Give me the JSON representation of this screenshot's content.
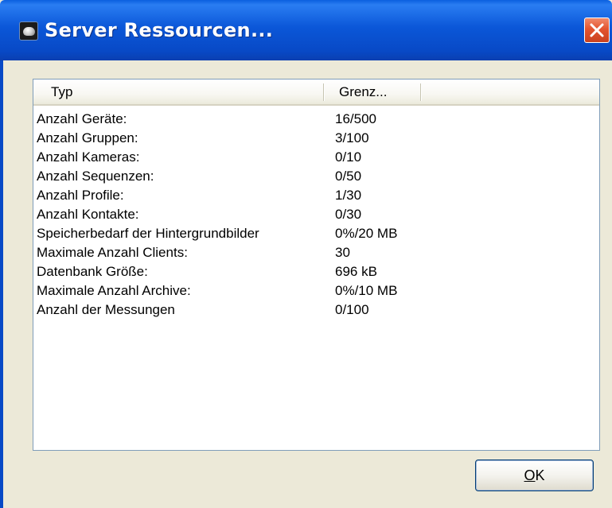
{
  "window": {
    "title": "Server Ressourcen...",
    "icon": "camera-dome-icon",
    "close_icon": "close-icon"
  },
  "list": {
    "columns": [
      "Typ",
      "Grenz..."
    ],
    "rows": [
      {
        "typ": "Anzahl Geräte:",
        "grenz": "16/500"
      },
      {
        "typ": "Anzahl Gruppen:",
        "grenz": "3/100"
      },
      {
        "typ": "Anzahl Kameras:",
        "grenz": "0/10"
      },
      {
        "typ": "Anzahl Sequenzen:",
        "grenz": "0/50"
      },
      {
        "typ": "Anzahl Profile:",
        "grenz": "1/30"
      },
      {
        "typ": "Anzahl Kontakte:",
        "grenz": "0/30"
      },
      {
        "typ": "Speicherbedarf der Hintergrundbilder",
        "grenz": "0%/20 MB"
      },
      {
        "typ": "Maximale Anzahl Clients:",
        "grenz": "30"
      },
      {
        "typ": "Datenbank Größe:",
        "grenz": "696 kB"
      },
      {
        "typ": "Maximale Anzahl Archive:",
        "grenz": "0%/10 MB"
      },
      {
        "typ": "Anzahl der Messungen",
        "grenz": "0/100"
      }
    ]
  },
  "buttons": {
    "ok_mnemonic": "O",
    "ok_rest": "K"
  },
  "colors": {
    "titlebar": "#0849c6",
    "close_button": "#e3542f",
    "dialog_bg": "#ece9d8"
  }
}
